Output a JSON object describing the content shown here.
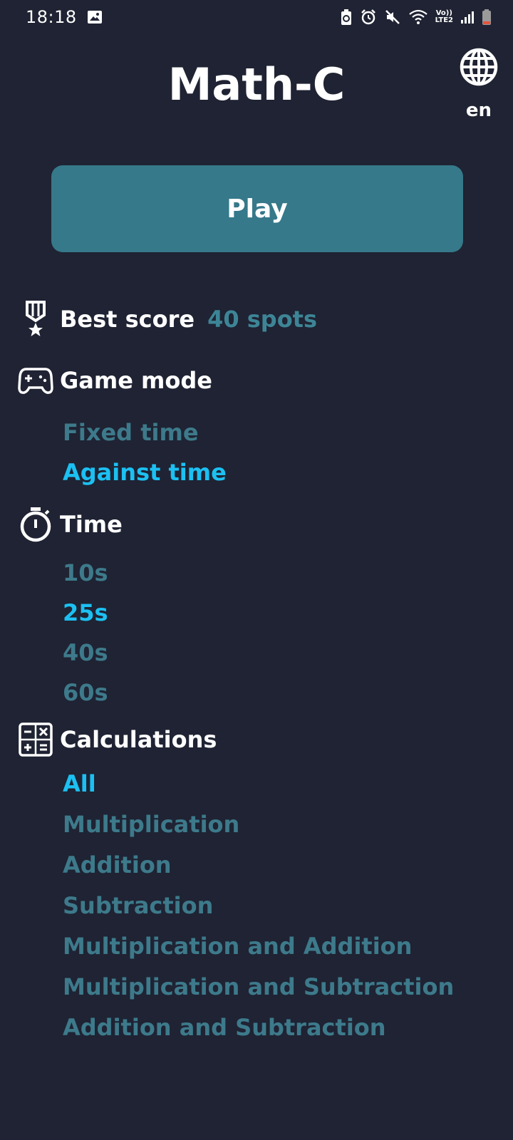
{
  "status_bar": {
    "time": "18:18",
    "network_label_top": "Vo))",
    "network_label_bottom": "LTE2"
  },
  "header": {
    "title": "Math-C",
    "language": "en"
  },
  "play_label": "Play",
  "best_score": {
    "label": "Best score",
    "value": "40 spots"
  },
  "game_mode": {
    "label": "Game mode",
    "options": [
      "Fixed time",
      "Against time"
    ],
    "selected": "Against time"
  },
  "time": {
    "label": "Time",
    "options": [
      "10s",
      "25s",
      "40s",
      "60s"
    ],
    "selected": "25s"
  },
  "calculations": {
    "label": "Calculations",
    "options": [
      "All",
      "Multiplication",
      "Addition",
      "Subtraction",
      "Multiplication and Addition",
      "Multiplication and Subtraction",
      "Addition and Subtraction"
    ],
    "selected": "All"
  },
  "colors": {
    "background": "#1f2333",
    "play_button": "#35798a",
    "option_default": "#3d7a8b",
    "option_selected": "#1cc0f2",
    "best_value": "#3d8596"
  }
}
